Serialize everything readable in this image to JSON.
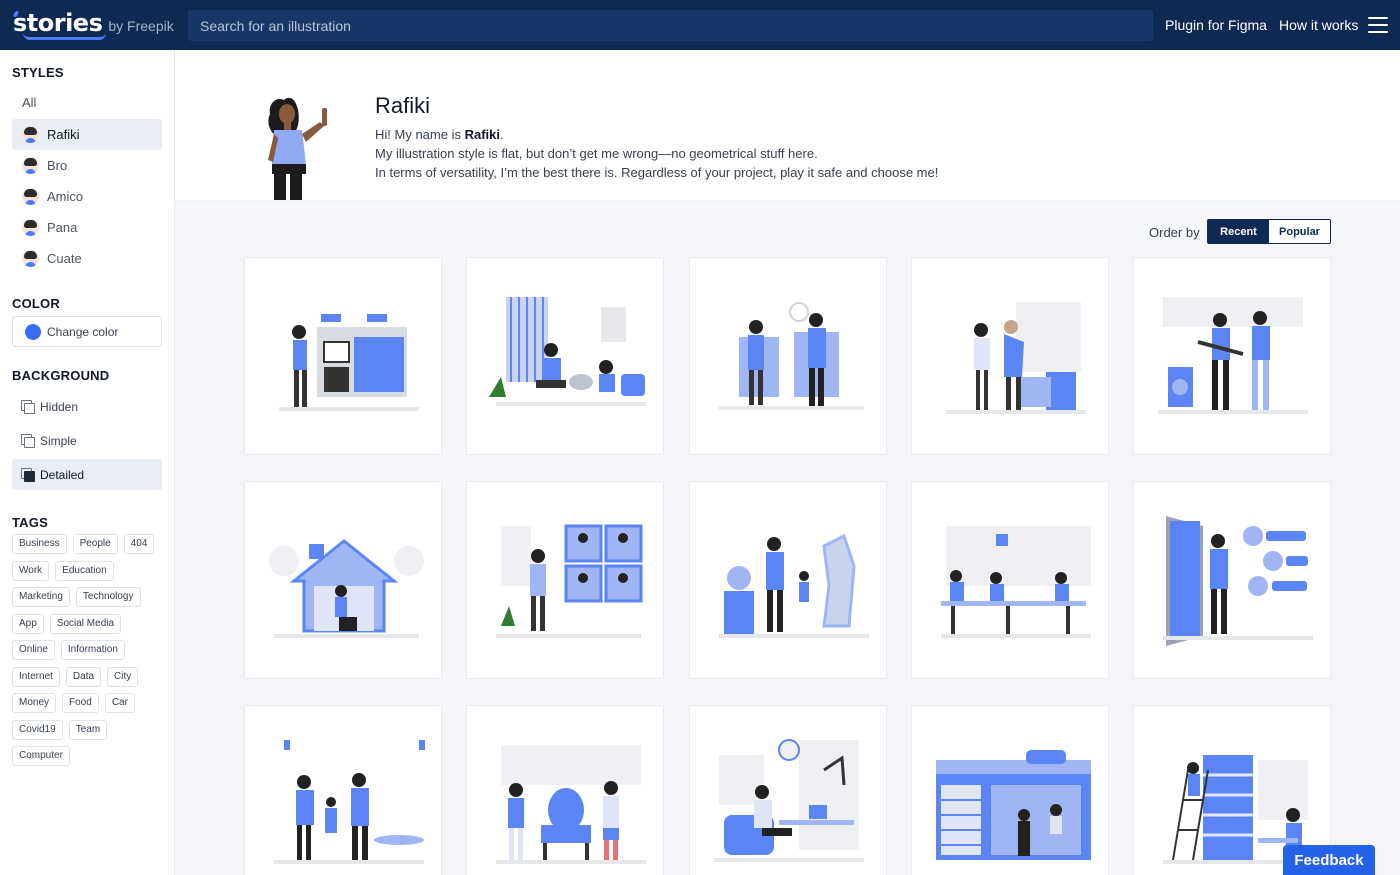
{
  "header": {
    "logo": "stories",
    "logo_by": "by Freepik",
    "search_placeholder": "Search for an illustration",
    "nav": {
      "plugin": "Plugin for Figma",
      "how": "How it works"
    }
  },
  "sidebar": {
    "styles_title": "STYLES",
    "styles": [
      "All",
      "Rafiki",
      "Bro",
      "Amico",
      "Pana",
      "Cuate"
    ],
    "selected_style": "Rafiki",
    "color_title": "COLOR",
    "color_label": "Change color",
    "accent_color": "#3b6cf6",
    "background_title": "BACKGROUND",
    "backgrounds": [
      "Hidden",
      "Simple",
      "Detailed"
    ],
    "selected_background": "Detailed",
    "tags_title": "TAGS",
    "tags": [
      "Business",
      "People",
      "404",
      "Work",
      "Education",
      "Marketing",
      "Technology",
      "App",
      "Social Media",
      "Online",
      "Information",
      "Internet",
      "Data",
      "City",
      "Money",
      "Food",
      "Car",
      "Covid19",
      "Team",
      "Computer"
    ]
  },
  "intro": {
    "title": "Rafiki",
    "line1_prefix": "Hi! My name is ",
    "line1_name": "Rafiki",
    "line1_suffix": ".",
    "line2": "My illustration style is flat, but don’t get me wrong—no geometrical stuff here.",
    "line3": "In terms of versatility, I’m the best there is. Regardless of your project, play it safe and choose me!"
  },
  "order": {
    "label": "Order by",
    "options": [
      "Recent",
      "Popular"
    ],
    "selected": "Recent"
  },
  "illustrations": [
    "house-agents-icon",
    "vet-clinic-icon",
    "video-call-icon",
    "elderly-care-icon",
    "music-band-icon",
    "home-repair-icon",
    "online-team-icon",
    "museum-visit-icon",
    "coworking-icon",
    "open-door-icon",
    "family-night-icon",
    "oktoberfest-icon",
    "remote-work-icon",
    "bookshop-icon",
    "library-icon"
  ],
  "feedback": "Feedback",
  "colors": {
    "header": "#0e2a52",
    "accent": "#3b6cf6",
    "feedback": "#2462e9"
  }
}
